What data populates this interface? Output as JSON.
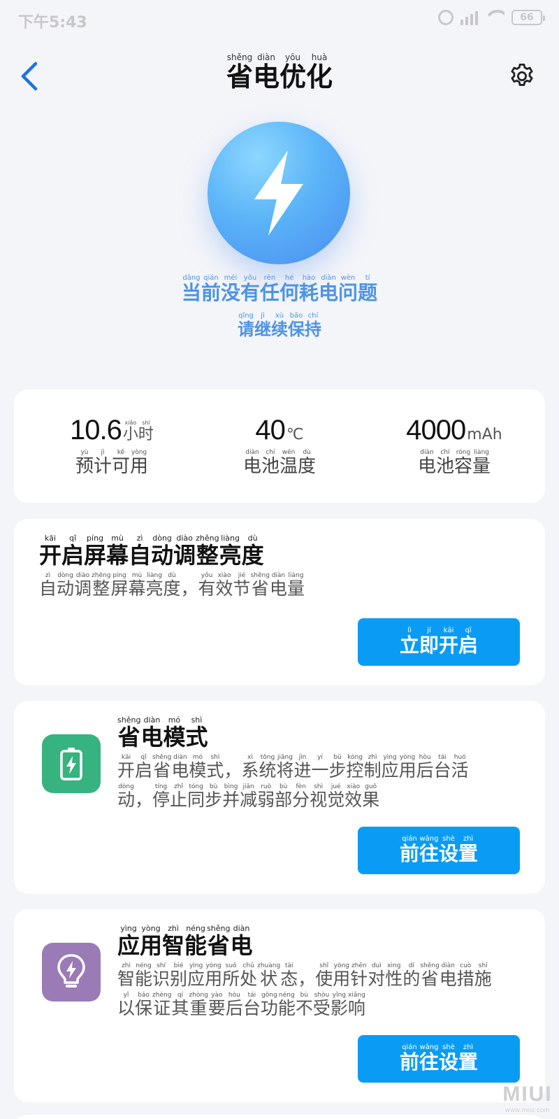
{
  "status_bar": {
    "time": "下午5:43",
    "battery": "66"
  },
  "header": {
    "title": [
      {
        "c": "省",
        "p": "shěng"
      },
      {
        "c": "电",
        "p": "diàn"
      },
      {
        "c": "优",
        "p": "yōu"
      },
      {
        "c": "化",
        "p": "huà"
      }
    ]
  },
  "hero": {
    "status": [
      {
        "c": "当",
        "p": "dāng"
      },
      {
        "c": "前",
        "p": "qián"
      },
      {
        "c": "没",
        "p": "méi"
      },
      {
        "c": "有",
        "p": "yǒu"
      },
      {
        "c": "任",
        "p": "rèn"
      },
      {
        "c": "何",
        "p": "hé"
      },
      {
        "c": "耗",
        "p": "hào"
      },
      {
        "c": "电",
        "p": "diàn"
      },
      {
        "c": "问",
        "p": "wèn"
      },
      {
        "c": "题",
        "p": "tí"
      }
    ],
    "subtitle": [
      {
        "c": "请",
        "p": "qǐng"
      },
      {
        "c": "继",
        "p": "jì"
      },
      {
        "c": "续",
        "p": "xù"
      },
      {
        "c": "保",
        "p": "bǎo"
      },
      {
        "c": "持",
        "p": "chí"
      }
    ]
  },
  "stats": [
    {
      "value": "10.6",
      "unit": [
        {
          "c": "小",
          "p": "xiǎo"
        },
        {
          "c": "时",
          "p": "shí"
        }
      ],
      "label": [
        {
          "c": "预",
          "p": "yù"
        },
        {
          "c": "计",
          "p": "jì"
        },
        {
          "c": "可",
          "p": "kě"
        },
        {
          "c": "用",
          "p": "yòng"
        }
      ]
    },
    {
      "value": "40",
      "unit": [
        {
          "c": "℃",
          "p": ""
        }
      ],
      "label": [
        {
          "c": "电",
          "p": "diàn"
        },
        {
          "c": "池",
          "p": "chí"
        },
        {
          "c": "温",
          "p": "wēn"
        },
        {
          "c": "度",
          "p": "dù"
        }
      ]
    },
    {
      "value": "4000",
      "unit": [
        {
          "c": "mAh",
          "p": ""
        }
      ],
      "label": [
        {
          "c": "电",
          "p": "diàn"
        },
        {
          "c": "池",
          "p": "chí"
        },
        {
          "c": "容",
          "p": "róng"
        },
        {
          "c": "量",
          "p": "liàng"
        }
      ]
    }
  ],
  "cards": [
    {
      "title": [
        {
          "c": "开",
          "p": "kāi"
        },
        {
          "c": "启",
          "p": "qǐ"
        },
        {
          "c": "屏",
          "p": "píng"
        },
        {
          "c": "幕",
          "p": "mù"
        },
        {
          "c": "自",
          "p": "zì"
        },
        {
          "c": "动",
          "p": "dòng"
        },
        {
          "c": "调",
          "p": "diào"
        },
        {
          "c": "整",
          "p": "zhěng"
        },
        {
          "c": "亮",
          "p": "liàng"
        },
        {
          "c": "度",
          "p": "dù"
        }
      ],
      "desc_lines": [
        [
          {
            "c": "自",
            "p": "zì"
          },
          {
            "c": "动",
            "p": "dòng"
          },
          {
            "c": "调",
            "p": "diào"
          },
          {
            "c": "整",
            "p": "zhěng"
          },
          {
            "c": "屏",
            "p": "píng"
          },
          {
            "c": "幕",
            "p": "mù"
          },
          {
            "c": "亮",
            "p": "liàng"
          },
          {
            "c": "度",
            "p": "dù"
          },
          {
            "c": "，",
            "p": ""
          },
          {
            "c": "有",
            "p": "yǒu"
          },
          {
            "c": "效",
            "p": "xiào"
          },
          {
            "c": "节",
            "p": "jié"
          },
          {
            "c": "省",
            "p": "shěng"
          },
          {
            "c": "电",
            "p": "diàn"
          },
          {
            "c": "量",
            "p": "liàng"
          }
        ]
      ],
      "button": [
        {
          "c": "立",
          "p": "lì"
        },
        {
          "c": "即",
          "p": "jí"
        },
        {
          "c": "开",
          "p": "kāi"
        },
        {
          "c": "启",
          "p": "qǐ"
        }
      ]
    },
    {
      "title": [
        {
          "c": "省",
          "p": "shěng"
        },
        {
          "c": "电",
          "p": "diàn"
        },
        {
          "c": "模",
          "p": "mó"
        },
        {
          "c": "式",
          "p": "shì"
        }
      ],
      "desc_lines": [
        [
          {
            "c": "开",
            "p": "kāi"
          },
          {
            "c": "启",
            "p": "qǐ"
          },
          {
            "c": "省",
            "p": "shěng"
          },
          {
            "c": "电",
            "p": "diàn"
          },
          {
            "c": "模",
            "p": "mó"
          },
          {
            "c": "式",
            "p": "shì"
          },
          {
            "c": "，",
            "p": ""
          },
          {
            "c": "系",
            "p": "xì"
          },
          {
            "c": "统",
            "p": "tǒng"
          },
          {
            "c": "将",
            "p": "jiāng"
          },
          {
            "c": "进",
            "p": "jìn"
          },
          {
            "c": "一",
            "p": "yí"
          },
          {
            "c": "步",
            "p": "bù"
          },
          {
            "c": "控",
            "p": "kòng"
          },
          {
            "c": "制",
            "p": "zhì"
          },
          {
            "c": "应",
            "p": "yìng"
          },
          {
            "c": "用",
            "p": "yòng"
          },
          {
            "c": "后",
            "p": "hòu"
          },
          {
            "c": "台",
            "p": "tái"
          },
          {
            "c": "活",
            "p": "huó"
          }
        ],
        [
          {
            "c": "动",
            "p": "dòng"
          },
          {
            "c": "，",
            "p": ""
          },
          {
            "c": "停",
            "p": "tíng"
          },
          {
            "c": "止",
            "p": "zhǐ"
          },
          {
            "c": "同",
            "p": "tóng"
          },
          {
            "c": "步",
            "p": "bù"
          },
          {
            "c": "并",
            "p": "bìng"
          },
          {
            "c": "减",
            "p": "jiǎn"
          },
          {
            "c": "弱",
            "p": "ruò"
          },
          {
            "c": "部",
            "p": "bù"
          },
          {
            "c": "分",
            "p": "fèn"
          },
          {
            "c": "视",
            "p": "shì"
          },
          {
            "c": "觉",
            "p": "jué"
          },
          {
            "c": "效",
            "p": "xiào"
          },
          {
            "c": "果",
            "p": "guǒ"
          }
        ]
      ],
      "button": [
        {
          "c": "前",
          "p": "qián"
        },
        {
          "c": "往",
          "p": "wǎng"
        },
        {
          "c": "设",
          "p": "shè"
        },
        {
          "c": "置",
          "p": "zhì"
        }
      ],
      "icon": "battery-icon",
      "icon_color": "#36b37e"
    },
    {
      "title": [
        {
          "c": "应",
          "p": "yìng"
        },
        {
          "c": "用",
          "p": "yòng"
        },
        {
          "c": "智",
          "p": "zhì"
        },
        {
          "c": "能",
          "p": "néng"
        },
        {
          "c": "省",
          "p": "shěng"
        },
        {
          "c": "电",
          "p": "diàn"
        }
      ],
      "desc_lines": [
        [
          {
            "c": "智",
            "p": "zhì"
          },
          {
            "c": "能",
            "p": "néng"
          },
          {
            "c": "识",
            "p": "shí"
          },
          {
            "c": "别",
            "p": "bié"
          },
          {
            "c": "应",
            "p": "yìng"
          },
          {
            "c": "用",
            "p": "yòng"
          },
          {
            "c": "所",
            "p": "suǒ"
          },
          {
            "c": "处",
            "p": "chǔ"
          },
          {
            "c": "状",
            "p": "zhuàng"
          },
          {
            "c": "态",
            "p": "tài"
          },
          {
            "c": "，",
            "p": ""
          },
          {
            "c": "使",
            "p": "shǐ"
          },
          {
            "c": "用",
            "p": "yòng"
          },
          {
            "c": "针",
            "p": "zhēn"
          },
          {
            "c": "对",
            "p": "duì"
          },
          {
            "c": "性",
            "p": "xìng"
          },
          {
            "c": "的",
            "p": "dí"
          },
          {
            "c": "省",
            "p": "shěng"
          },
          {
            "c": "电",
            "p": "diàn"
          },
          {
            "c": "措",
            "p": "cuò"
          },
          {
            "c": "施",
            "p": "shī"
          }
        ],
        [
          {
            "c": "以",
            "p": "yǐ"
          },
          {
            "c": "保",
            "p": "bǎo"
          },
          {
            "c": "证",
            "p": "zhèng"
          },
          {
            "c": "其",
            "p": "qí"
          },
          {
            "c": "重",
            "p": "zhòng"
          },
          {
            "c": "要",
            "p": "yào"
          },
          {
            "c": "后",
            "p": "hòu"
          },
          {
            "c": "台",
            "p": "tái"
          },
          {
            "c": "功",
            "p": "gōng"
          },
          {
            "c": "能",
            "p": "néng"
          },
          {
            "c": "不",
            "p": "bù"
          },
          {
            "c": "受",
            "p": "shòu"
          },
          {
            "c": "影",
            "p": "yǐng"
          },
          {
            "c": "响",
            "p": "xiǎng"
          }
        ]
      ],
      "button": [
        {
          "c": "前",
          "p": "qián"
        },
        {
          "c": "往",
          "p": "wǎng"
        },
        {
          "c": "设",
          "p": "shè"
        },
        {
          "c": "置",
          "p": "zhì"
        }
      ],
      "icon": "lightbulb-icon",
      "icon_color": "#9b7bb5"
    }
  ],
  "watermark": {
    "logo": "MIUI",
    "url": "www.miui.com"
  },
  "colors": {
    "accent": "#0a9cf5",
    "hero_text": "#4d93e8",
    "background": "#f4f5f9"
  }
}
